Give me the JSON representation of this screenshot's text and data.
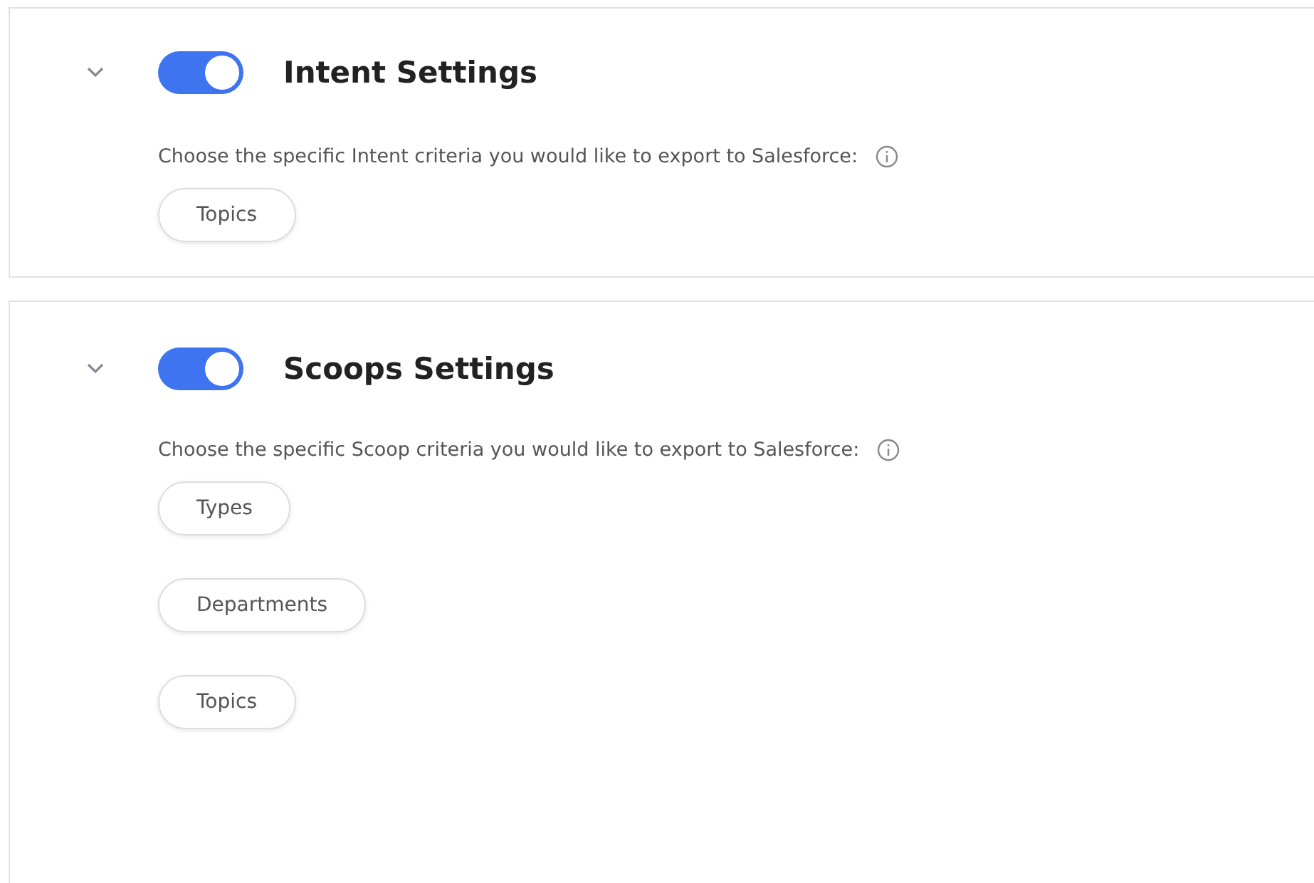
{
  "sections": [
    {
      "title": "Intent Settings",
      "expanded": true,
      "enabled": true,
      "description": "Choose the specific Intent criteria you would like to export to Salesforce:",
      "options": [
        {
          "label": "Topics"
        }
      ]
    },
    {
      "title": "Scoops Settings",
      "expanded": true,
      "enabled": true,
      "description": "Choose the specific Scoop criteria you would like to export to Salesforce:",
      "options": [
        {
          "label": "Types"
        },
        {
          "label": "Departments"
        },
        {
          "label": "Topics"
        }
      ]
    }
  ]
}
